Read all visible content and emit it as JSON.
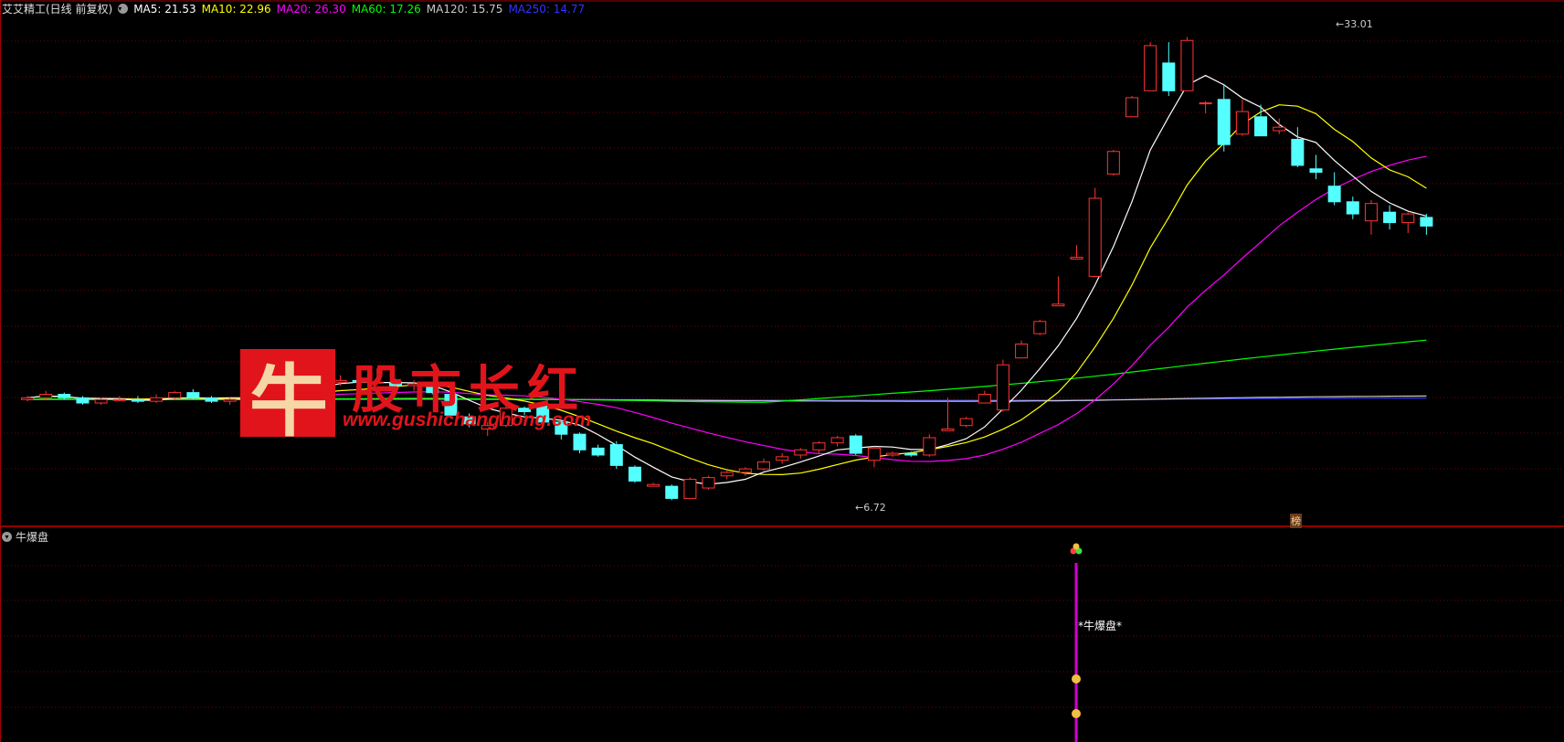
{
  "header": {
    "stock_title": "艾艾精工(日线 前复权)",
    "ma5": "MA5: 21.53",
    "ma10": "MA10: 22.96",
    "ma20": "MA20: 26.30",
    "ma60": "MA60: 17.26",
    "ma120": "MA120: 15.75",
    "ma250": "MA250: 14.77"
  },
  "colors": {
    "background": "#000000",
    "up": "#ff3333",
    "down": "#54ffff",
    "ma5": "#ffffff",
    "ma10": "#ffff00",
    "ma20": "#ff00ff",
    "ma60": "#00ff00",
    "ma120": "#c8c8c8",
    "ma250": "#3333ff",
    "grid": "#8b0000",
    "signal": "#d000d0"
  },
  "watermark": {
    "logo_char": "牛",
    "name": "股市长红",
    "url": "www.gushichanghong.com"
  },
  "subpanel": {
    "title": "牛爆盘",
    "signal_label": "*牛爆盘*"
  },
  "annotations": {
    "high": "33.01",
    "low": "6.72",
    "tag": "榜"
  },
  "chart_data": {
    "type": "candlestick",
    "ylim": [
      5.0,
      34.5
    ],
    "grid": true,
    "high_mark": 33.01,
    "low_mark": 6.72,
    "candles": [
      [
        12.1,
        12.3,
        12.0,
        12.2
      ],
      [
        12.2,
        12.6,
        12.1,
        12.4
      ],
      [
        12.4,
        12.5,
        12.1,
        12.2
      ],
      [
        12.2,
        12.3,
        11.8,
        11.9
      ],
      [
        11.9,
        12.2,
        11.8,
        12.1
      ],
      [
        12.1,
        12.3,
        12.0,
        12.1
      ],
      [
        12.1,
        12.3,
        11.9,
        12.0
      ],
      [
        12.0,
        12.4,
        11.9,
        12.2
      ],
      [
        12.2,
        12.6,
        12.1,
        12.5
      ],
      [
        12.5,
        12.7,
        12.1,
        12.2
      ],
      [
        12.2,
        12.3,
        11.9,
        12.0
      ],
      [
        12.0,
        12.2,
        11.8,
        12.1
      ],
      [
        12.1,
        12.3,
        11.9,
        12.2
      ],
      [
        12.2,
        12.8,
        12.0,
        12.7
      ],
      [
        12.7,
        13.4,
        12.6,
        13.2
      ],
      [
        13.2,
        13.4,
        12.8,
        12.9
      ],
      [
        12.9,
        13.3,
        12.7,
        13.1
      ],
      [
        13.1,
        13.5,
        12.9,
        13.2
      ],
      [
        13.2,
        13.6,
        13.0,
        13.1
      ],
      [
        13.1,
        13.9,
        13.0,
        13.1
      ],
      [
        13.1,
        13.3,
        12.8,
        12.9
      ],
      [
        12.9,
        13.2,
        12.6,
        13.0
      ],
      [
        12.9,
        13.0,
        12.4,
        12.5
      ],
      [
        12.4,
        12.5,
        11.0,
        11.2
      ],
      [
        11.1,
        11.3,
        10.5,
        10.7
      ],
      [
        10.4,
        10.8,
        10.0,
        10.6
      ],
      [
        10.6,
        11.8,
        10.5,
        11.6
      ],
      [
        11.6,
        11.7,
        11.2,
        11.4
      ],
      [
        11.7,
        11.9,
        10.6,
        10.8
      ],
      [
        10.8,
        10.9,
        9.8,
        10.1
      ],
      [
        10.1,
        10.2,
        9.0,
        9.2
      ],
      [
        9.3,
        9.5,
        8.8,
        8.9
      ],
      [
        9.5,
        9.7,
        8.1,
        8.3
      ],
      [
        8.2,
        8.3,
        7.3,
        7.4
      ],
      [
        7.1,
        7.3,
        7.1,
        7.2
      ],
      [
        7.1,
        7.2,
        6.3,
        6.4
      ],
      [
        6.4,
        7.6,
        6.4,
        7.5
      ],
      [
        7.0,
        7.7,
        6.9,
        7.6
      ],
      [
        7.7,
        8.0,
        7.5,
        7.9
      ],
      [
        7.9,
        8.2,
        7.7,
        8.1
      ],
      [
        8.1,
        8.7,
        8.0,
        8.5
      ],
      [
        8.6,
        9.0,
        8.4,
        8.8
      ],
      [
        8.9,
        9.3,
        8.7,
        9.2
      ],
      [
        9.2,
        9.7,
        9.0,
        9.6
      ],
      [
        9.6,
        10.0,
        9.4,
        9.9
      ],
      [
        10.0,
        10.1,
        8.9,
        9.0
      ],
      [
        8.6,
        9.4,
        8.2,
        9.3
      ],
      [
        8.9,
        9.1,
        8.8,
        9.0
      ],
      [
        9.0,
        9.1,
        8.8,
        8.9
      ],
      [
        8.9,
        10.1,
        8.8,
        9.9
      ],
      [
        10.3,
        12.2,
        10.3,
        10.4
      ],
      [
        10.6,
        11.1,
        10.5,
        11.0
      ],
      [
        11.9,
        12.6,
        11.9,
        12.4
      ],
      [
        11.5,
        14.4,
        11.4,
        14.1
      ],
      [
        14.5,
        15.5,
        14.5,
        15.3
      ],
      [
        15.9,
        16.7,
        15.8,
        16.6
      ],
      [
        17.5,
        19.2,
        17.5,
        17.6
      ],
      [
        20.2,
        21.0,
        20.2,
        20.3
      ],
      [
        19.2,
        24.3,
        19.2,
        23.7
      ],
      [
        25.1,
        26.5,
        25.0,
        26.4
      ],
      [
        28.4,
        29.6,
        28.4,
        29.5
      ],
      [
        29.9,
        32.7,
        29.9,
        32.5
      ],
      [
        31.5,
        32.7,
        29.6,
        29.9
      ],
      [
        29.9,
        33.0,
        29.9,
        32.8
      ],
      [
        29.2,
        29.3,
        28.6,
        29.2
      ],
      [
        29.4,
        30.3,
        26.4,
        26.8
      ],
      [
        27.4,
        29.4,
        27.3,
        28.7
      ],
      [
        28.4,
        29.1,
        27.3,
        27.3
      ],
      [
        27.6,
        28.3,
        27.4,
        27.8
      ],
      [
        27.1,
        27.8,
        25.5,
        25.6
      ],
      [
        25.4,
        26.2,
        24.8,
        25.2
      ],
      [
        24.4,
        25.2,
        23.3,
        23.5
      ],
      [
        23.5,
        23.8,
        22.5,
        22.8
      ],
      [
        22.4,
        23.6,
        21.6,
        23.4
      ],
      [
        22.9,
        23.3,
        21.9,
        22.3
      ],
      [
        22.3,
        22.9,
        21.7,
        22.8
      ],
      [
        22.6,
        22.8,
        21.6,
        22.1
      ]
    ]
  }
}
